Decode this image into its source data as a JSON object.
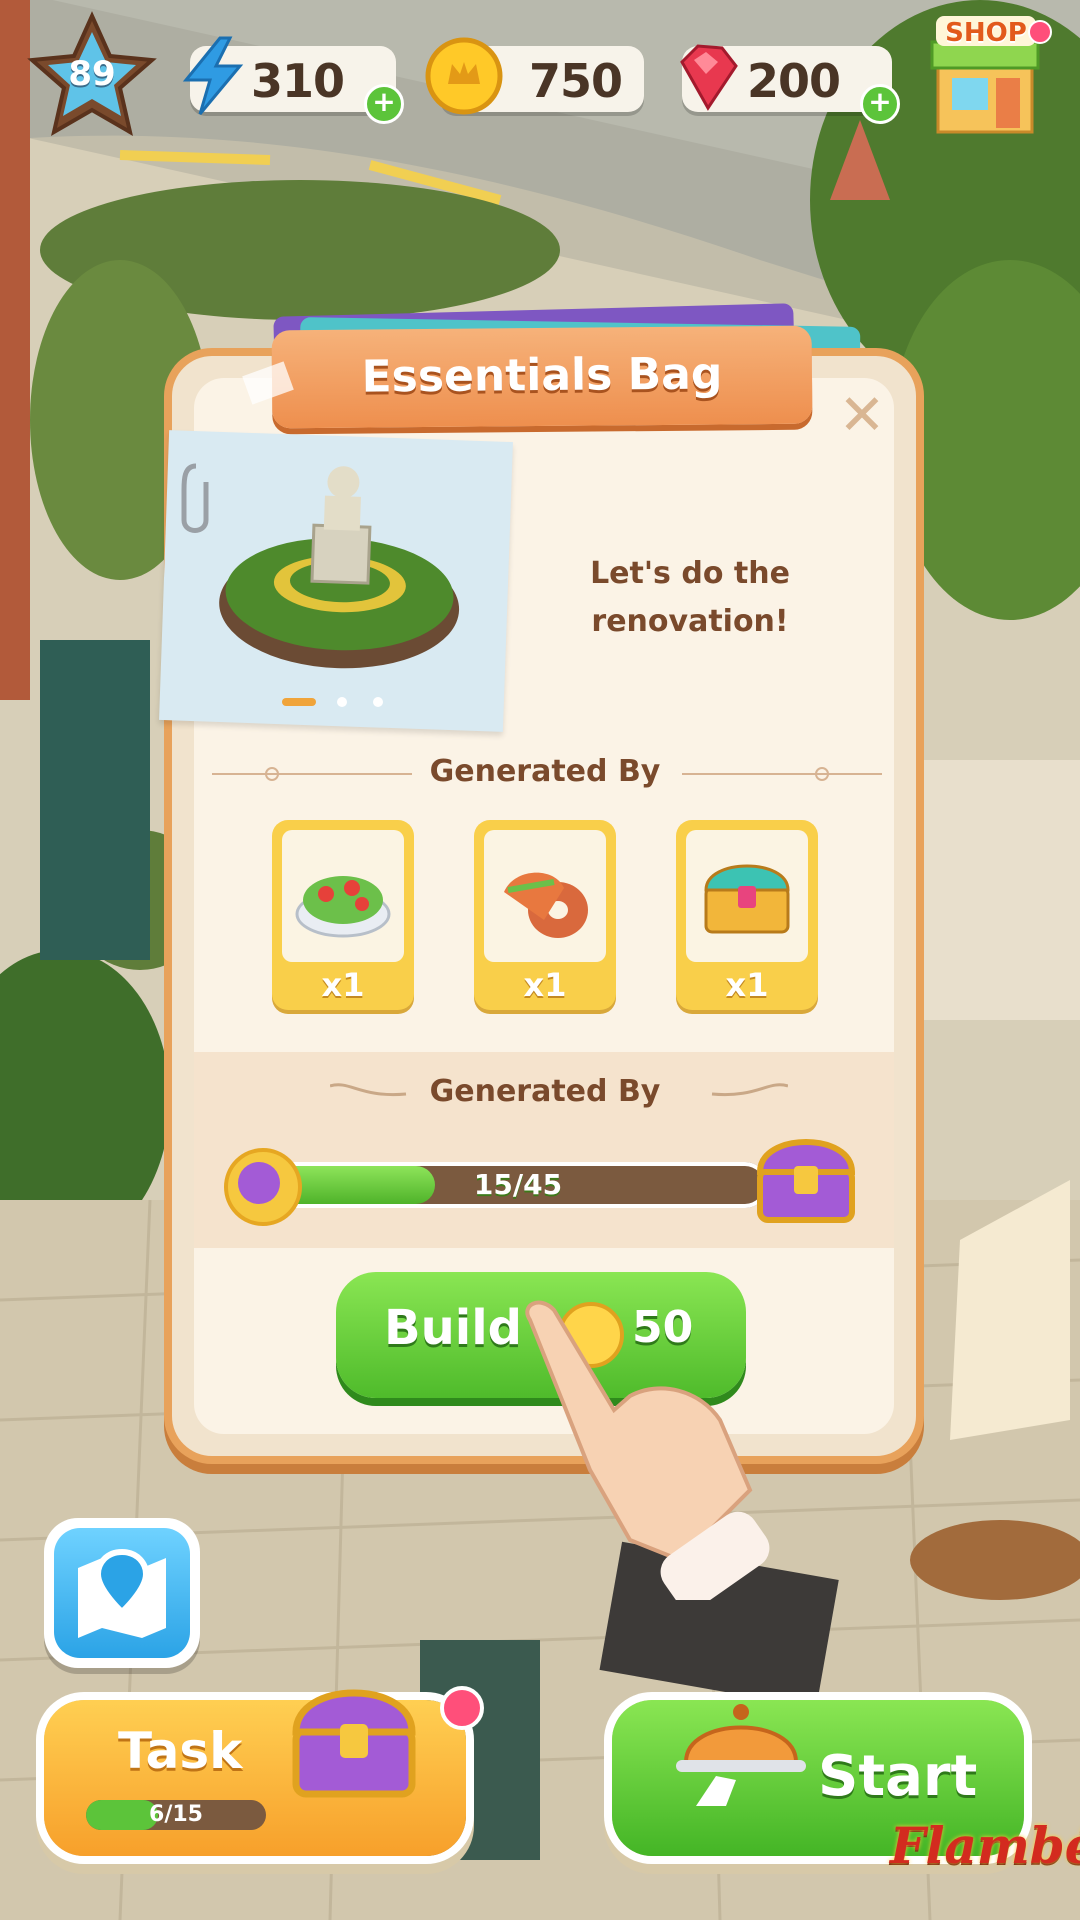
{
  "hud": {
    "level": "89",
    "energy": "310",
    "coins": "750",
    "gems": "200",
    "plus": "+",
    "shop_label": "SHOP"
  },
  "dialog": {
    "title": "Essentials Bag",
    "close": "✕",
    "tagline": "Let's do the renovation!",
    "section1_title": "Generated By",
    "items": [
      {
        "icon": "salad-icon",
        "qty": "x1"
      },
      {
        "icon": "bagel-sandwich-icon",
        "qty": "x1"
      },
      {
        "icon": "treasure-chest-icon",
        "qty": "x1"
      }
    ],
    "section2_title": "Generated By",
    "progress": {
      "text": "15/45",
      "current": 15,
      "total": 45
    },
    "build_label": "Build",
    "build_cost": "50"
  },
  "bottom": {
    "task_label": "Task",
    "task_progress": "6/15",
    "task_current": 6,
    "task_total": 15,
    "start_label": "Start",
    "logo": "Flambé"
  },
  "colors": {
    "accent_orange": "#ee8f4e",
    "button_green": "#4fbb2b",
    "panel": "#fbf3e6",
    "text_brown": "#7a4a2c"
  }
}
